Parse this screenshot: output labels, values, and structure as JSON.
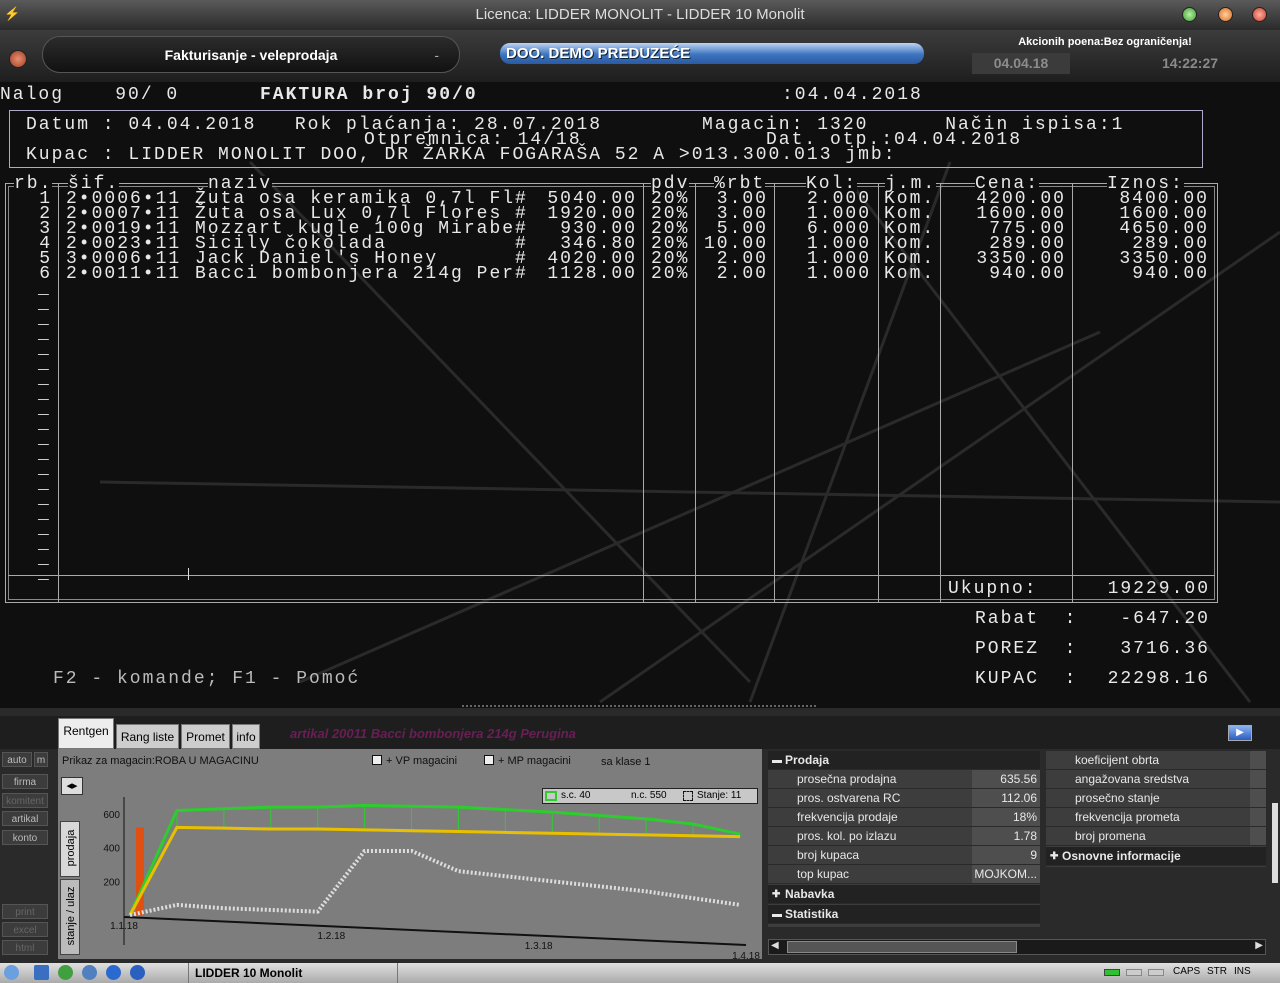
{
  "window": {
    "title": "Licenca: LIDDER MONOLIT - LIDDER 10 Monolit"
  },
  "header": {
    "module": "Fakturisanje - veleprodaja",
    "module_dash": "-",
    "company": "DOO. DEMO PREDUZEĆE",
    "akcioni_poeni": "Akcionih poena:Bez ograničenja!",
    "date": "04.04.18",
    "time": "14:22:27"
  },
  "invoice": {
    "line_nalog": "Nalog    90/ 0",
    "line_faktura": "FAKTURA broj 90/0",
    "line_date": ":04.04.2018",
    "line1_left": "Datum : 04.04.2018   Rok plaćanja: 28.07.2018",
    "line1_right": "Magacin: 1320      Način ispisa:1",
    "line2_left": "Otpremnica: 14/18",
    "line2_right": "Dat. otp.:04.04.2018",
    "line3": "Kupac : LIDDER MONOLIT DOO, DR ŽARKA FOGARAŠA 52 A >013.300.013 jmb:",
    "col_rb": "rb.",
    "col_sif": "šif.",
    "col_naziv": "naziv",
    "col_pdv": "pdv",
    "col_rbt": "%rbt",
    "col_kol": "Kol:",
    "col_jm": "j.m.",
    "col_cena": "Cena:",
    "col_iznos": "Iznos:",
    "rows": [
      {
        "rb": "1",
        "sif": "2•0006•11",
        "naziv": "Žuta osa keramika 0,7l Fl#",
        "nc": "5040.00",
        "pdv": "20%",
        "rbt": "3.00",
        "kol": "2.000",
        "jm": "Kom.",
        "cena": "4200.00",
        "iznos": "8400.00"
      },
      {
        "rb": "2",
        "sif": "2•0007•11",
        "naziv": "Žuta osa Lux 0,7l Flores #",
        "nc": "1920.00",
        "pdv": "20%",
        "rbt": "3.00",
        "kol": "1.000",
        "jm": "Kom.",
        "cena": "1600.00",
        "iznos": "1600.00"
      },
      {
        "rb": "3",
        "sif": "2•0019•11",
        "naziv": "Mozzart kugle 100g Mirabe#",
        "nc": "930.00",
        "pdv": "20%",
        "rbt": "5.00",
        "kol": "6.000",
        "jm": "Kom.",
        "cena": "775.00",
        "iznos": "4650.00"
      },
      {
        "rb": "4",
        "sif": "2•0023•11",
        "naziv": "Sicily čokolada          #",
        "nc": "346.80",
        "pdv": "20%",
        "rbt": "10.00",
        "kol": "1.000",
        "jm": "Kom.",
        "cena": "289.00",
        "iznos": "289.00"
      },
      {
        "rb": "5",
        "sif": "3•0006•11",
        "naziv": "Jack Daniel's Honey      #",
        "nc": "4020.00",
        "pdv": "20%",
        "rbt": "2.00",
        "kol": "1.000",
        "jm": "Kom.",
        "cena": "3350.00",
        "iznos": "3350.00"
      },
      {
        "rb": "6",
        "sif": "2•0011•11",
        "naziv": "Bacci bombonjera 214g Per#",
        "nc": "1128.00",
        "pdv": "20%",
        "rbt": "2.00",
        "kol": "1.000",
        "jm": "Kom.",
        "cena": "940.00",
        "iznos": "940.00"
      }
    ],
    "empty_marker": "_",
    "ukupno_label": "Ukupno:",
    "ukupno_value": "19229.00",
    "rabat_label": "Rabat  :",
    "rabat_value": "-647.20",
    "porez_label": "POREZ  :",
    "porez_value": "3716.36",
    "kupac_label": "KUPAC  :",
    "kupac_value": "22298.16",
    "hint": "F2 - komande; F1 - Pomoć"
  },
  "bottom": {
    "tabs": [
      "Rentgen",
      "Rang liste",
      "Promet",
      "info"
    ],
    "active_tab": "Rentgen",
    "article_title": "artikal 20011 Bacci bombonjera 214g Perugina",
    "side_buttons_top": [
      "auto",
      "m"
    ],
    "side_buttons": [
      "firma",
      "komitent",
      "artikal",
      "konto"
    ],
    "side_export": [
      "print",
      "excel",
      "html"
    ],
    "magacin_label": "Prikaz za magacin:ROBA U MAGACINU",
    "vp_label": "+ VP magacini",
    "mp_label": "+ MP magacini",
    "klase_label": "sa klase 1",
    "vtab_prodaja": "prodaja",
    "vtab_stanje": "stanje / ulaz",
    "legend": [
      "s.c. 40",
      "n.c. 550",
      "Stanje: 11"
    ],
    "nav_left": "◂",
    "nav_right": "▸",
    "prodaja_section": "Prodaja",
    "prodaja_rows": [
      {
        "k": "prosečna prodajna",
        "v": "635.56"
      },
      {
        "k": "pros. ostvarena RC",
        "v": "112.06"
      },
      {
        "k": "frekvencija prodaje",
        "v": "18%"
      },
      {
        "k": "pros. kol. po izlazu",
        "v": "1.78"
      },
      {
        "k": "broj kupaca",
        "v": "9"
      },
      {
        "k": "top kupac",
        "v": "MOJKOM..."
      }
    ],
    "nabavka_section": "Nabavka",
    "statistika_section": "Statistika",
    "right_rows": [
      "koeficijent obrta",
      "angažovana sredstva",
      "prosečno stanje",
      "frekvencija prometa",
      "broj promena"
    ],
    "osnovne_section": "Osnovne informacije"
  },
  "chart_data": {
    "type": "line",
    "ylim": [
      0,
      700
    ],
    "yticks": [
      200,
      400,
      600
    ],
    "xticks": [
      "1.1.18",
      "1.2.18",
      "1.3.18",
      "1.4.18"
    ],
    "series": [
      {
        "name": "s.c. 40",
        "color": "#2ecc2e",
        "values": [
          0,
          620,
          630,
          640,
          640,
          650,
          645,
          640,
          625,
          610,
          590,
          570,
          540,
          480
        ]
      },
      {
        "name": "n.c. 550",
        "color": "#e8c000",
        "values": [
          0,
          520,
          515,
          510,
          510,
          505,
          500,
          495,
          490,
          485,
          480,
          475,
          470,
          465
        ]
      },
      {
        "name": "Stanje: 11",
        "color": "#dddddd",
        "values": [
          0,
          60,
          40,
          30,
          20,
          380,
          380,
          260,
          230,
          200,
          170,
          140,
          100,
          60
        ]
      }
    ]
  },
  "taskbar": {
    "app": "LIDDER 10 Monolit",
    "keys": [
      "CAPS",
      "STR",
      "INS"
    ]
  }
}
